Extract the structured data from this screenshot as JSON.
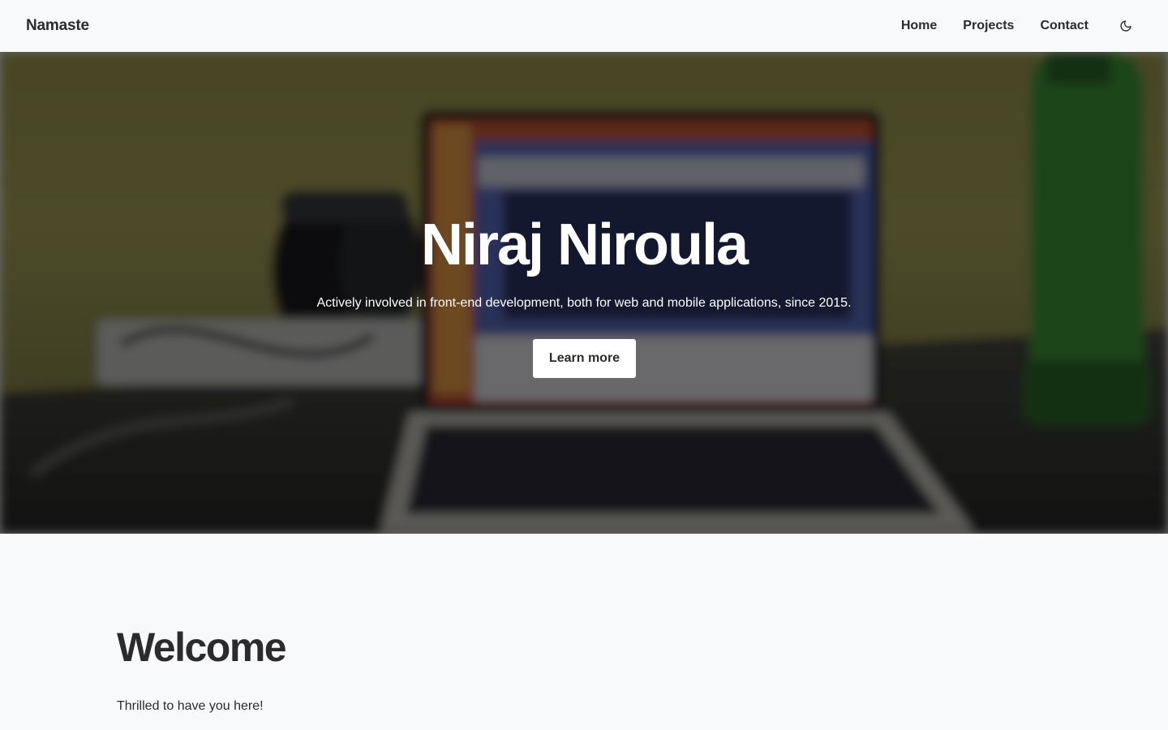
{
  "nav": {
    "brand": "Namaste",
    "links": [
      {
        "label": "Home"
      },
      {
        "label": "Projects"
      },
      {
        "label": "Contact"
      }
    ],
    "theme_toggle_icon": "moon-icon"
  },
  "hero": {
    "title": "Niraj Niroula",
    "subtitle": "Actively involved in front-end development, both for web and mobile applications, since 2015.",
    "button_label": "Learn more",
    "overlay_color": "#000000"
  },
  "welcome": {
    "title": "Welcome",
    "text": "Thrilled to have you here!"
  },
  "colors": {
    "background": "#f8f9fb",
    "text": "#2b2b2e",
    "hero_text": "#ffffff",
    "button_bg": "#ffffff"
  }
}
